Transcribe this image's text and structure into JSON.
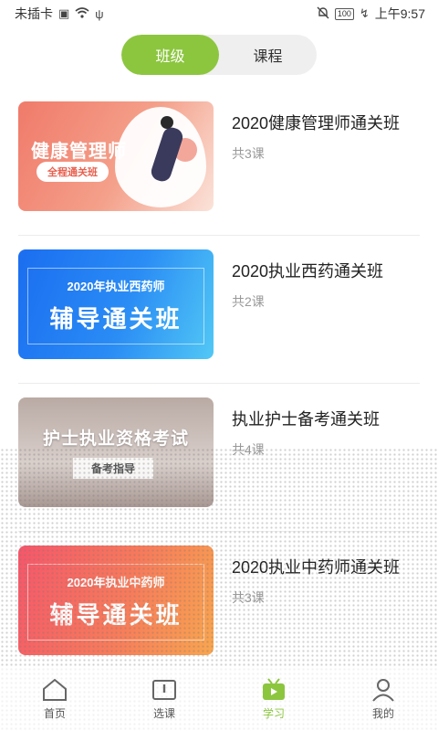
{
  "status_bar": {
    "carrier": "未插卡",
    "battery": "100",
    "time": "上午9:57"
  },
  "segment": {
    "tabs": [
      {
        "label": "班级",
        "active": true
      },
      {
        "label": "课程",
        "active": false
      }
    ]
  },
  "courses": [
    {
      "title": "2020健康管理师通关班",
      "count": "共3课",
      "thumb": {
        "main": "健康管理师",
        "tag": "全程通关班"
      }
    },
    {
      "title": "2020执业西药通关班",
      "count": "共2课",
      "thumb": {
        "sub": "2020年执业西药师",
        "main": "辅导通关班"
      }
    },
    {
      "title": "执业护士备考通关班",
      "count": "共4课",
      "thumb": {
        "main": "护士执业资格考试",
        "tag": "备考指导"
      }
    },
    {
      "title": "2020执业中药师通关班",
      "count": "共3课",
      "thumb": {
        "sub": "2020年执业中药师",
        "main": "辅导通关班"
      }
    }
  ],
  "bottom_nav": [
    {
      "label": "首页",
      "icon": "home-icon",
      "active": false
    },
    {
      "label": "选课",
      "icon": "book-icon",
      "active": false
    },
    {
      "label": "学习",
      "icon": "tv-icon",
      "active": true
    },
    {
      "label": "我的",
      "icon": "person-icon",
      "active": false
    }
  ],
  "colors": {
    "accent": "#8cc63f",
    "segment_bg": "#efefef"
  }
}
